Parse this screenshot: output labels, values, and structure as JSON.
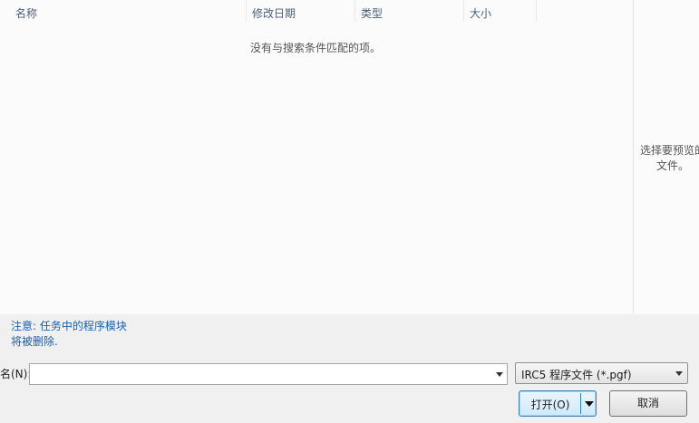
{
  "columns": {
    "name": "名称",
    "date_modified": "修改日期",
    "type": "类型",
    "size": "大小"
  },
  "sort_indicator": "ˆ",
  "file_list": {
    "empty_message": "没有与搜索条件匹配的项。"
  },
  "preview": {
    "message": "选择要预览的\n文件。"
  },
  "note": "注意: 任务中的程序模块\n将被删除.",
  "filename": {
    "label": "名(N):",
    "value": "",
    "placeholder": ""
  },
  "filetype": {
    "selected": "IRC5 程序文件 (*.pgf)"
  },
  "buttons": {
    "open": "打开(O)",
    "cancel": "取消"
  }
}
